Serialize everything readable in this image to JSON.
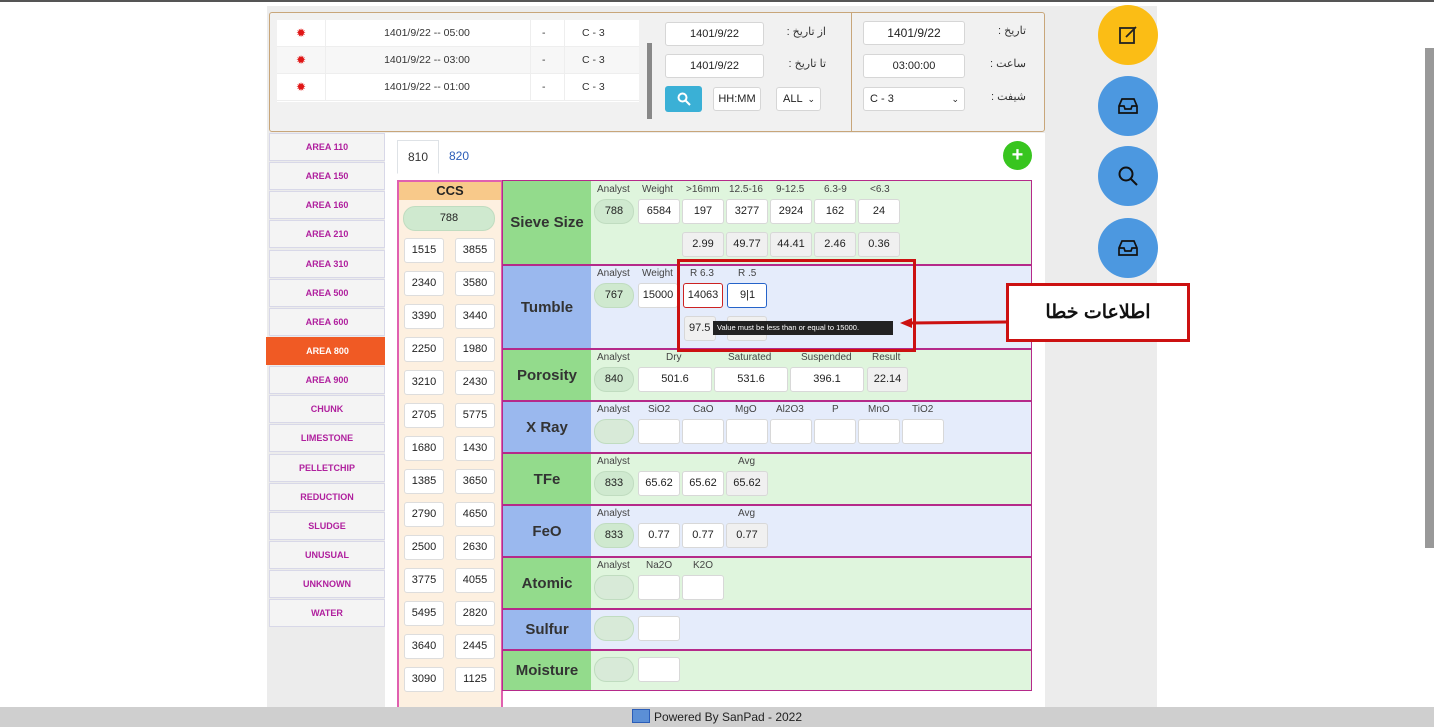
{
  "header": {
    "date_label": "تاریخ :",
    "date_value": "1401/9/22",
    "time_label": "ساعت :",
    "time_value": "03:00:00",
    "shift_label": "شیفت :",
    "shift_value": "C - 3",
    "from_label": "از تاریخ :",
    "from_value": "1401/9/22",
    "to_label": "تا تاریخ :",
    "to_value": "1401/9/22",
    "hhmm_placeholder": "HH:MM",
    "all_value": "ALL",
    "records": [
      {
        "datetime": "1401/9/22 -- 05:00",
        "dash": "-",
        "shift": "C - 3"
      },
      {
        "datetime": "1401/9/22 -- 03:00",
        "dash": "-",
        "shift": "C - 3"
      },
      {
        "datetime": "1401/9/22 -- 01:00",
        "dash": "-",
        "shift": "C - 3"
      }
    ]
  },
  "sidebar": {
    "items": [
      "AREA 110",
      "AREA 150",
      "AREA 160",
      "AREA 210",
      "AREA 310",
      "AREA 500",
      "AREA 600",
      "AREA 800",
      "AREA 900",
      "CHUNK",
      "LIMESTONE",
      "PELLETCHIP",
      "REDUCTION",
      "SLUDGE",
      "UNUSUAL",
      "UNKNOWN",
      "WATER"
    ],
    "active": "AREA 800"
  },
  "tabs": [
    "810",
    "820"
  ],
  "ccs": {
    "title": "CCS",
    "analyst": "788",
    "values": [
      [
        "1515",
        "3855"
      ],
      [
        "2340",
        "3580"
      ],
      [
        "3390",
        "3440"
      ],
      [
        "2250",
        "1980"
      ],
      [
        "3210",
        "2430"
      ],
      [
        "2705",
        "5775"
      ],
      [
        "1680",
        "1430"
      ],
      [
        "1385",
        "3650"
      ],
      [
        "2790",
        "4650"
      ],
      [
        "2500",
        "2630"
      ],
      [
        "3775",
        "4055"
      ],
      [
        "5495",
        "2820"
      ],
      [
        "3640",
        "2445"
      ],
      [
        "3090",
        "1125"
      ]
    ]
  },
  "sieve": {
    "name": "Sieve Size",
    "headers": [
      "Analyst",
      "Weight",
      ">16mm",
      "12.5-16",
      "9-12.5",
      "6.3-9",
      "<6.3"
    ],
    "analyst": "788",
    "weight": "6584",
    "values": [
      "197",
      "3277",
      "2924",
      "162",
      "24"
    ],
    "percents": [
      "2.99",
      "49.77",
      "44.41",
      "2.46",
      "0.36"
    ]
  },
  "tumble": {
    "name": "Tumble",
    "headers": [
      "Analyst",
      "Weight",
      "R 6.3",
      "R .5"
    ],
    "analyst": "767",
    "weight": "15000",
    "r63": "14063",
    "r5": "9|1",
    "pct": "97.5"
  },
  "porosity": {
    "name": "Porosity",
    "headers": [
      "Analyst",
      "Dry",
      "Saturated",
      "Suspended",
      "Result"
    ],
    "analyst": "840",
    "dry": "501.6",
    "saturated": "531.6",
    "suspended": "396.1",
    "result": "22.14"
  },
  "xray": {
    "name": "X Ray",
    "headers": [
      "Analyst",
      "SiO2",
      "CaO",
      "MgO",
      "Al2O3",
      "P",
      "MnO",
      "TiO2"
    ]
  },
  "tfe": {
    "name": "TFe",
    "headers": [
      "Analyst",
      "Avg"
    ],
    "analyst": "833",
    "v1": "65.62",
    "v2": "65.62",
    "avg": "65.62"
  },
  "feo": {
    "name": "FeO",
    "headers": [
      "Analyst",
      "Avg"
    ],
    "analyst": "833",
    "v1": "0.77",
    "v2": "0.77",
    "avg": "0.77"
  },
  "atomic": {
    "name": "Atomic",
    "headers": [
      "Analyst",
      "Na2O",
      "K2O"
    ]
  },
  "sulfur": {
    "name": "Sulfur"
  },
  "moisture": {
    "name": "Moisture"
  },
  "tooltip": "Value must be less than or equal to 15000.",
  "callout": "اطلاعات خطا",
  "footer": "Powered By SanPad - 2022",
  "colors": {
    "accent_orange": "#f05a24",
    "area_text": "#b0209e",
    "error_red": "#cc1111",
    "add_green": "#38c51f"
  }
}
